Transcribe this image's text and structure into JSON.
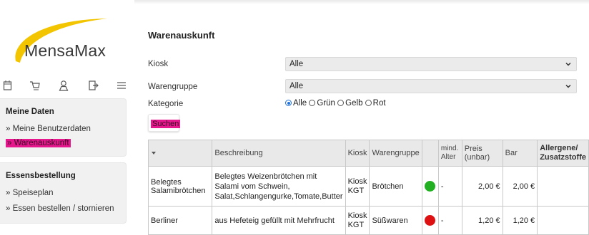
{
  "app": {
    "logo_text": "MensaMax"
  },
  "sidebar": {
    "sections": [
      {
        "title": "Meine Daten",
        "items": [
          "» Meine Benutzerdaten",
          "» Warenauskunft"
        ]
      },
      {
        "title": "Essensbestellung",
        "items": [
          "» Speiseplan",
          "» Essen bestellen / stornieren"
        ]
      }
    ],
    "icons": [
      "calendar-icon",
      "cart-icon",
      "user-icon",
      "logout-icon",
      "menu-icon"
    ]
  },
  "main": {
    "title": "Warenauskunft",
    "kiosk": {
      "label": "Kiosk",
      "value": "Alle"
    },
    "warengruppe": {
      "label": "Warengruppe",
      "value": "Alle"
    },
    "kategorie": {
      "label": "Kategorie",
      "options": [
        "Alle",
        "Grün",
        "Gelb",
        "Rot"
      ],
      "selected": "Alle"
    },
    "search_label": "Suchen"
  },
  "table": {
    "headers": [
      "",
      "Beschreibung",
      "Kiosk",
      "Warengruppe",
      "",
      "mind. Alter",
      "Preis (unbar)",
      "Bar",
      "Allergene/ Zusatzstoffe"
    ],
    "rows": [
      {
        "name": "Belegtes Salamibrötchen",
        "desc": "Belegtes Weizenbrötchen mit Salami vom Schwein, Salat,Schlangengurke,Tomate,Butter",
        "kiosk": "Kiosk KGT",
        "gruppe": "Brötchen",
        "status_color": "#22b022",
        "alter": "-",
        "preis": "2,00 €",
        "bar": "2,00 €",
        "allergene": ""
      },
      {
        "name": "Berliner",
        "desc": "aus Hefeteig gefüllt mit Mehrfrucht",
        "kiosk": "Kiosk KGT",
        "gruppe": "Süßwaren",
        "status_color": "#dd1111",
        "alter": "-",
        "preis": "1,20 €",
        "bar": "1,20 €",
        "allergene": ""
      }
    ]
  },
  "colors": {
    "highlight": "#e6168d",
    "logo_arc": "#f2c500",
    "radio": "#1e6fd9"
  }
}
